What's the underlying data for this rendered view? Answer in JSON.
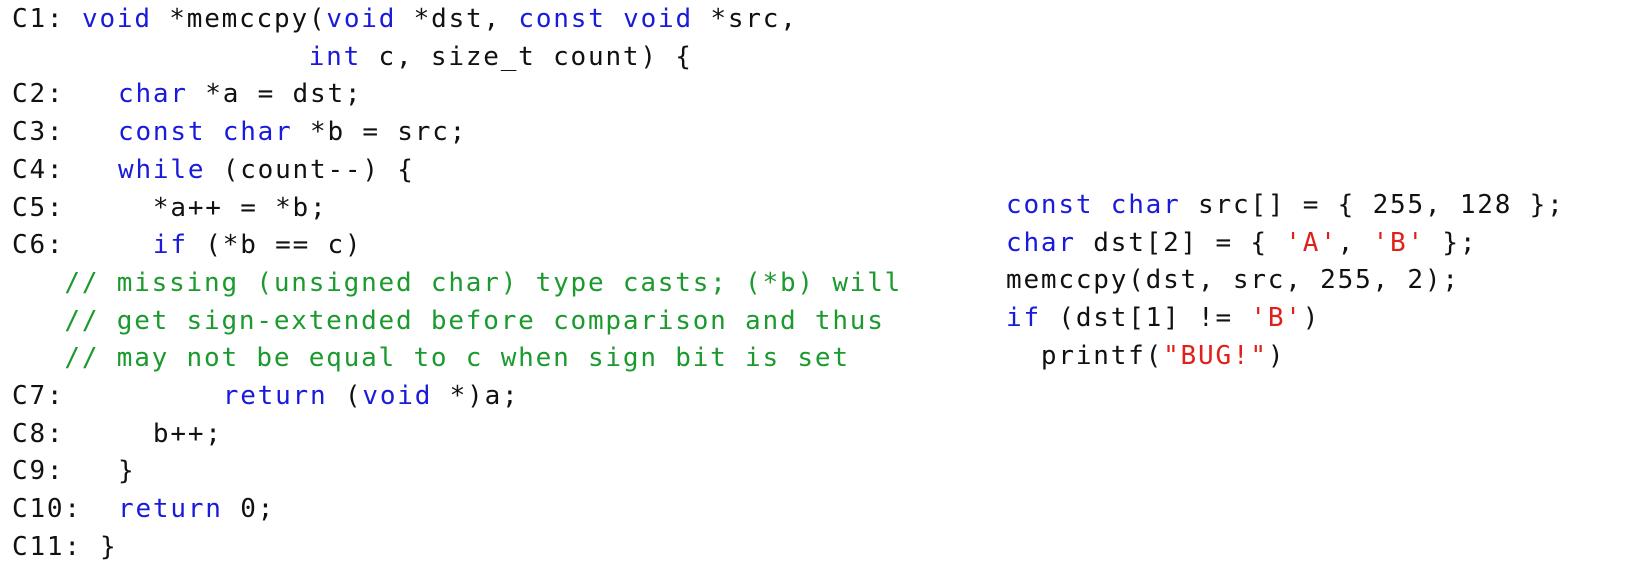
{
  "colors": {
    "keyword": "#1a1adb",
    "comment": "#1b9a2e",
    "string": "#e0201a",
    "text": "#111111",
    "background": "#ffffff"
  },
  "left_code": [
    {
      "label": "C1:",
      "indent": "",
      "tokens": [
        {
          "t": "kw",
          "v": "void"
        },
        {
          "t": "pl",
          "v": " *memccpy("
        },
        {
          "t": "kw",
          "v": "void"
        },
        {
          "t": "pl",
          "v": " *dst, "
        },
        {
          "t": "kw",
          "v": "const"
        },
        {
          "t": "pl",
          "v": " "
        },
        {
          "t": "kw",
          "v": "void"
        },
        {
          "t": "pl",
          "v": " *src,"
        }
      ]
    },
    {
      "label": "",
      "indent": "                 ",
      "tokens": [
        {
          "t": "kw",
          "v": "int"
        },
        {
          "t": "pl",
          "v": " c, size_t count) {"
        }
      ]
    },
    {
      "label": "C2:",
      "indent": "",
      "tokens": [
        {
          "t": "kw",
          "v": "char"
        },
        {
          "t": "pl",
          "v": " *a = dst;"
        }
      ]
    },
    {
      "label": "C3:",
      "indent": "",
      "tokens": [
        {
          "t": "kw",
          "v": "const"
        },
        {
          "t": "pl",
          "v": " "
        },
        {
          "t": "kw",
          "v": "char"
        },
        {
          "t": "pl",
          "v": " *b = src;"
        }
      ]
    },
    {
      "label": "C4:",
      "indent": "",
      "tokens": [
        {
          "t": "kw",
          "v": "while"
        },
        {
          "t": "pl",
          "v": " (count--) {"
        }
      ]
    },
    {
      "label": "C5:",
      "indent": "  ",
      "tokens": [
        {
          "t": "pl",
          "v": "*a++ = *b;"
        }
      ]
    },
    {
      "label": "C6:",
      "indent": "  ",
      "tokens": [
        {
          "t": "kw",
          "v": "if"
        },
        {
          "t": "pl",
          "v": " (*b == c)"
        }
      ]
    },
    {
      "label": "",
      "indent": "   ",
      "tokens": [
        {
          "t": "cm",
          "v": "// missing (unsigned char) type casts; (*b) will"
        }
      ]
    },
    {
      "label": "",
      "indent": "   ",
      "tokens": [
        {
          "t": "cm",
          "v": "// get sign-extended before comparison and thus"
        }
      ]
    },
    {
      "label": "",
      "indent": "   ",
      "tokens": [
        {
          "t": "cm",
          "v": "// may not be equal to c when sign bit is set"
        }
      ]
    },
    {
      "label": "C7:",
      "indent": "      ",
      "tokens": [
        {
          "t": "kw",
          "v": "return"
        },
        {
          "t": "pl",
          "v": " ("
        },
        {
          "t": "kw",
          "v": "void"
        },
        {
          "t": "pl",
          "v": " *)a;"
        }
      ]
    },
    {
      "label": "C8:",
      "indent": "  ",
      "tokens": [
        {
          "t": "pl",
          "v": "b++;"
        }
      ]
    },
    {
      "label": "C9:",
      "indent": "",
      "tokens": [
        {
          "t": "pl",
          "v": "}"
        }
      ]
    },
    {
      "label": "C10:",
      "indent": "",
      "tokens": [
        {
          "t": "kw",
          "v": "return"
        },
        {
          "t": "pl",
          "v": " 0;"
        }
      ]
    },
    {
      "label": "C11:",
      "indent": "",
      "tokens": [
        {
          "t": "pl",
          "v": "}"
        }
      ]
    }
  ],
  "right_code": [
    {
      "tokens": [
        {
          "t": "kw",
          "v": "const"
        },
        {
          "t": "pl",
          "v": " "
        },
        {
          "t": "kw",
          "v": "char"
        },
        {
          "t": "pl",
          "v": " src[] = { 255, 128 };"
        }
      ]
    },
    {
      "tokens": [
        {
          "t": "kw",
          "v": "char"
        },
        {
          "t": "pl",
          "v": " dst[2] = { "
        },
        {
          "t": "str",
          "v": "'A'"
        },
        {
          "t": "pl",
          "v": ", "
        },
        {
          "t": "str",
          "v": "'B'"
        },
        {
          "t": "pl",
          "v": " };"
        }
      ]
    },
    {
      "tokens": [
        {
          "t": "pl",
          "v": "memccpy(dst, src, 255, 2);"
        }
      ]
    },
    {
      "tokens": [
        {
          "t": "kw",
          "v": "if"
        },
        {
          "t": "pl",
          "v": " (dst[1] != "
        },
        {
          "t": "str",
          "v": "'B'"
        },
        {
          "t": "pl",
          "v": ")"
        }
      ]
    },
    {
      "tokens": [
        {
          "t": "pl",
          "v": "  printf("
        },
        {
          "t": "str",
          "v": "\"BUG!\""
        },
        {
          "t": "pl",
          "v": ")"
        }
      ]
    }
  ]
}
